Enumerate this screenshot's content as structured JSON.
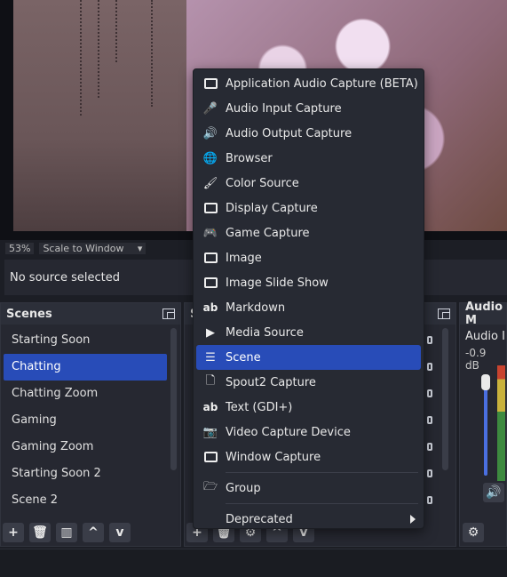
{
  "preview": {
    "zoom": "53%",
    "scale_label": "Scale to Window"
  },
  "source_bar": {
    "text": "No source selected"
  },
  "scenes": {
    "title": "Scenes",
    "items": [
      "Starting Soon",
      "Chatting",
      "Chatting Zoom",
      "Gaming",
      "Gaming Zoom",
      "Starting Soon 2",
      "Scene 2"
    ],
    "selected_index": 1,
    "toolbar": {
      "add": "+",
      "remove": "🗑",
      "filter": "▥",
      "up": "^",
      "down": "v"
    }
  },
  "sources": {
    "title": "S",
    "toolbar": {
      "add": "+",
      "remove": "🗑",
      "settings": "⚙",
      "up": "^",
      "down": "v"
    }
  },
  "audio": {
    "title": "Audio M",
    "channel": "Audio In",
    "db": "-0.9 dB"
  },
  "menu": {
    "items": [
      {
        "label": "Application Audio Capture (BETA)",
        "icon": "speaker-box-icon"
      },
      {
        "label": "Audio Input Capture",
        "icon": "microphone-icon"
      },
      {
        "label": "Audio Output Capture",
        "icon": "speaker-icon"
      },
      {
        "label": "Browser",
        "icon": "globe-icon"
      },
      {
        "label": "Color Source",
        "icon": "paintbrush-icon"
      },
      {
        "label": "Display Capture",
        "icon": "monitor-icon"
      },
      {
        "label": "Game Capture",
        "icon": "gamepad-icon"
      },
      {
        "label": "Image",
        "icon": "image-icon"
      },
      {
        "label": "Image Slide Show",
        "icon": "slideshow-icon"
      },
      {
        "label": "Markdown",
        "icon": "text-ab-icon"
      },
      {
        "label": "Media Source",
        "icon": "play-icon"
      },
      {
        "label": "Scene",
        "icon": "list-icon"
      },
      {
        "label": "Spout2 Capture",
        "icon": "file-icon"
      },
      {
        "label": "Text (GDI+)",
        "icon": "text-ab-icon"
      },
      {
        "label": "Video Capture Device",
        "icon": "camera-icon"
      },
      {
        "label": "Window Capture",
        "icon": "window-icon"
      }
    ],
    "selected_index": 11,
    "group": "Group",
    "deprecated": "Deprecated",
    "ab_glyph": "ab"
  }
}
